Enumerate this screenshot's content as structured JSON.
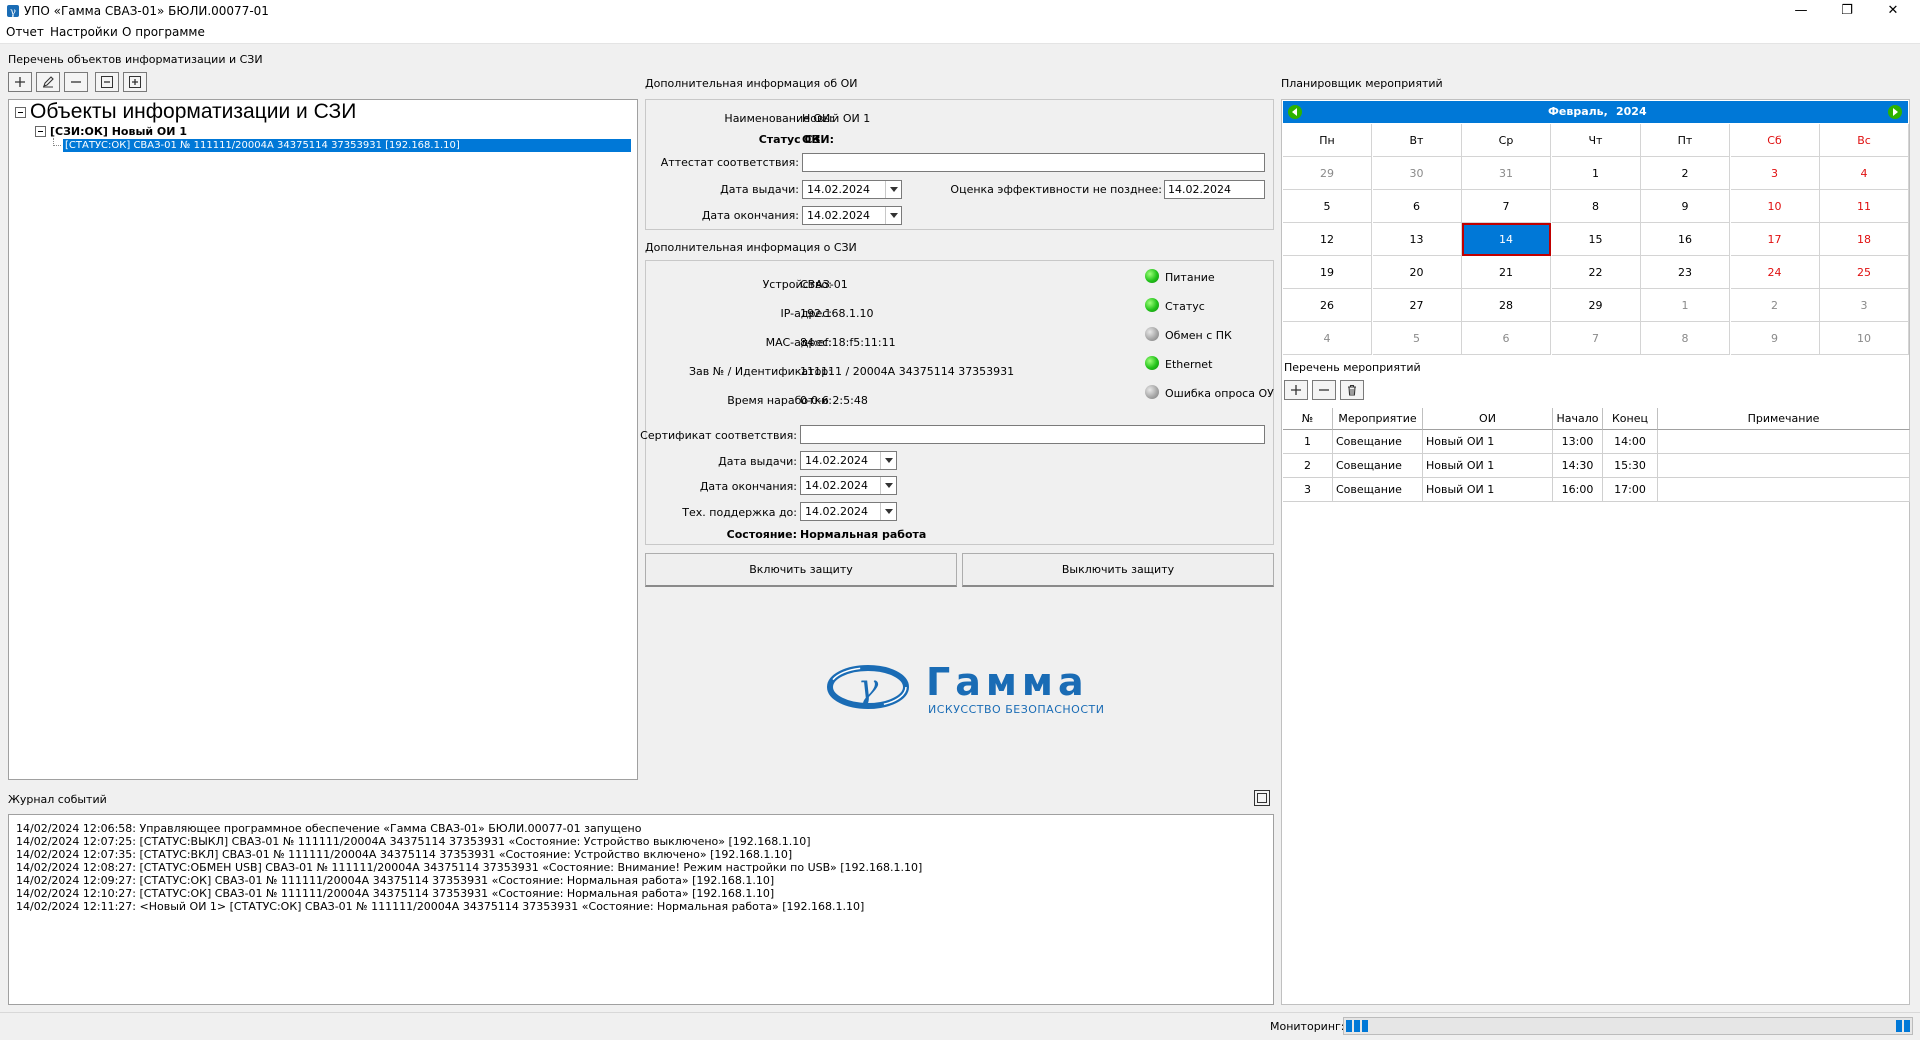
{
  "window": {
    "title": "УПО «Гамма СВАЗ-01» БЮЛИ.00077-01"
  },
  "menu": {
    "items": [
      "Отчет",
      "Настройки",
      "О программе"
    ]
  },
  "objects": {
    "section_label": "Перечень объектов информатизации и СЗИ",
    "tree_root": "Объекты информатизации и СЗИ",
    "tree_child": "[СЗИ:ОК] Новый ОИ 1",
    "tree_leaf": "[СТАТУС:ОК] СВАЗ-01 № 111111/20004А 34375114 37353931 [192.168.1.10]"
  },
  "oi_info": {
    "section_label": "Дополнительная информация об ОИ",
    "name_label": "Наименование ОИ:",
    "name_value": "Новый ОИ 1",
    "szi_status_label": "Статус СЗИ:",
    "szi_status_value": "ОК",
    "attestat_label": "Аттестат соответствия:",
    "attestat_value": "",
    "issue_date_label": "Дата выдачи:",
    "issue_date_value": "14.02.2024",
    "end_date_label": "Дата окончания:",
    "end_date_value": "14.02.2024",
    "eval_label": "Оценка эффективности не позднее:",
    "eval_value": "14.02.2024"
  },
  "szi_info": {
    "section_label": "Дополнительная информация о СЗИ",
    "device_label": "Устройство:",
    "device_value": "СВАЗ-01",
    "ip_label": "IP-адрес:",
    "ip_value": "192.168.1.10",
    "mac_label": "MAC-адрес:",
    "mac_value": "84:ef:18:f5:11:11",
    "serial_label": "Зав № / Идентификатор:",
    "serial_value": "111111 / 20004A 34375114 37353931",
    "uptime_label": "Время наработки:",
    "uptime_value": "0-0-6 2:5:48",
    "cert_label": "Сертификат соответствия:",
    "cert_value": "",
    "issue_date_label": "Дата выдачи:",
    "issue_date_value": "14.02.2024",
    "end_date_label": "Дата окончания:",
    "end_date_value": "14.02.2024",
    "support_label": "Тех. поддержка до:",
    "support_value": "14.02.2024",
    "state_label": "Состояние:",
    "state_value": "Нормальная работа",
    "indicators": [
      {
        "label": "Питание",
        "state": "green"
      },
      {
        "label": "Статус",
        "state": "green"
      },
      {
        "label": "Обмен с ПК",
        "state": "gray"
      },
      {
        "label": "Ethernet",
        "state": "green"
      },
      {
        "label": "Ошибка опроса ОУ",
        "state": "gray"
      }
    ]
  },
  "buttons": {
    "enable": "Включить защиту",
    "disable": "Выключить защиту"
  },
  "logo": {
    "name": "Гамма",
    "tagline": "ИСКУССТВО БЕЗОПАСНОСТИ",
    "color": "#1a6cb5"
  },
  "planner": {
    "section_label": "Планировщик мероприятий",
    "month_label": "Февраль,",
    "year_label": "2024",
    "weekdays": [
      "Пн",
      "Вт",
      "Ср",
      "Чт",
      "Пт",
      "Сб",
      "Вс"
    ],
    "weeks": [
      [
        {
          "d": "29",
          "m": "prev"
        },
        {
          "d": "30",
          "m": "prev"
        },
        {
          "d": "31",
          "m": "prev"
        },
        {
          "d": "1",
          "m": "cur"
        },
        {
          "d": "2",
          "m": "cur"
        },
        {
          "d": "3",
          "m": "cur"
        },
        {
          "d": "4",
          "m": "cur"
        }
      ],
      [
        {
          "d": "5",
          "m": "cur"
        },
        {
          "d": "6",
          "m": "cur"
        },
        {
          "d": "7",
          "m": "cur"
        },
        {
          "d": "8",
          "m": "cur"
        },
        {
          "d": "9",
          "m": "cur"
        },
        {
          "d": "10",
          "m": "cur"
        },
        {
          "d": "11",
          "m": "cur"
        }
      ],
      [
        {
          "d": "12",
          "m": "cur"
        },
        {
          "d": "13",
          "m": "cur"
        },
        {
          "d": "14",
          "m": "sel"
        },
        {
          "d": "15",
          "m": "cur"
        },
        {
          "d": "16",
          "m": "cur"
        },
        {
          "d": "17",
          "m": "cur"
        },
        {
          "d": "18",
          "m": "cur"
        }
      ],
      [
        {
          "d": "19",
          "m": "cur"
        },
        {
          "d": "20",
          "m": "cur"
        },
        {
          "d": "21",
          "m": "cur"
        },
        {
          "d": "22",
          "m": "cur"
        },
        {
          "d": "23",
          "m": "cur"
        },
        {
          "d": "24",
          "m": "cur"
        },
        {
          "d": "25",
          "m": "cur"
        }
      ],
      [
        {
          "d": "26",
          "m": "cur"
        },
        {
          "d": "27",
          "m": "cur"
        },
        {
          "d": "28",
          "m": "cur"
        },
        {
          "d": "29",
          "m": "cur"
        },
        {
          "d": "1",
          "m": "next"
        },
        {
          "d": "2",
          "m": "next"
        },
        {
          "d": "3",
          "m": "next"
        }
      ],
      [
        {
          "d": "4",
          "m": "next"
        },
        {
          "d": "5",
          "m": "next"
        },
        {
          "d": "6",
          "m": "next"
        },
        {
          "d": "7",
          "m": "next"
        },
        {
          "d": "8",
          "m": "next"
        },
        {
          "d": "9",
          "m": "next"
        },
        {
          "d": "10",
          "m": "next"
        }
      ]
    ],
    "events_label": "Перечень мероприятий",
    "columns": [
      "№",
      "Мероприятие",
      "ОИ",
      "Начало",
      "Конец",
      "Примечание"
    ],
    "rows": [
      [
        "1",
        "Совещание",
        "Новый ОИ 1",
        "13:00",
        "14:00",
        ""
      ],
      [
        "2",
        "Совещание",
        "Новый ОИ 1",
        "14:30",
        "15:30",
        ""
      ],
      [
        "3",
        "Совещание",
        "Новый ОИ 1",
        "16:00",
        "17:00",
        ""
      ]
    ]
  },
  "journal": {
    "section_label": "Журнал событий",
    "lines": [
      "14/02/2024 12:06:58: Управляющее программное обеспечение «Гамма СВАЗ-01» БЮЛИ.00077-01 запущено",
      "14/02/2024 12:07:25: [СТАТУС:ВЫКЛ] СВАЗ-01 № 111111/20004А 34375114 37353931 «Состояние: Устройство выключено» [192.168.1.10]",
      "14/02/2024 12:07:35: [СТАТУС:ВКЛ] СВАЗ-01 № 111111/20004А 34375114 37353931 «Состояние: Устройство включено» [192.168.1.10]",
      "14/02/2024 12:08:27: [СТАТУС:ОБМЕН USB] СВАЗ-01 № 111111/20004А 34375114 37353931 «Состояние: Внимание! Режим настройки по USB» [192.168.1.10]",
      "14/02/2024 12:09:27: [СТАТУС:ОК] СВАЗ-01 № 111111/20004А 34375114 37353931 «Состояние: Нормальная работа» [192.168.1.10]",
      "14/02/2024 12:10:27: [СТАТУС:ОК] СВАЗ-01 № 111111/20004А 34375114 37353931 «Состояние: Нормальная работа» [192.168.1.10]",
      "14/02/2024 12:11:27: <Новый ОИ 1> [СТАТУС:ОК] СВАЗ-01 № 111111/20004А 34375114 37353931 «Состояние: Нормальная работа» [192.168.1.10]"
    ]
  },
  "status": {
    "monitoring_label": "Мониторинг:",
    "accent": "#0078d7"
  }
}
